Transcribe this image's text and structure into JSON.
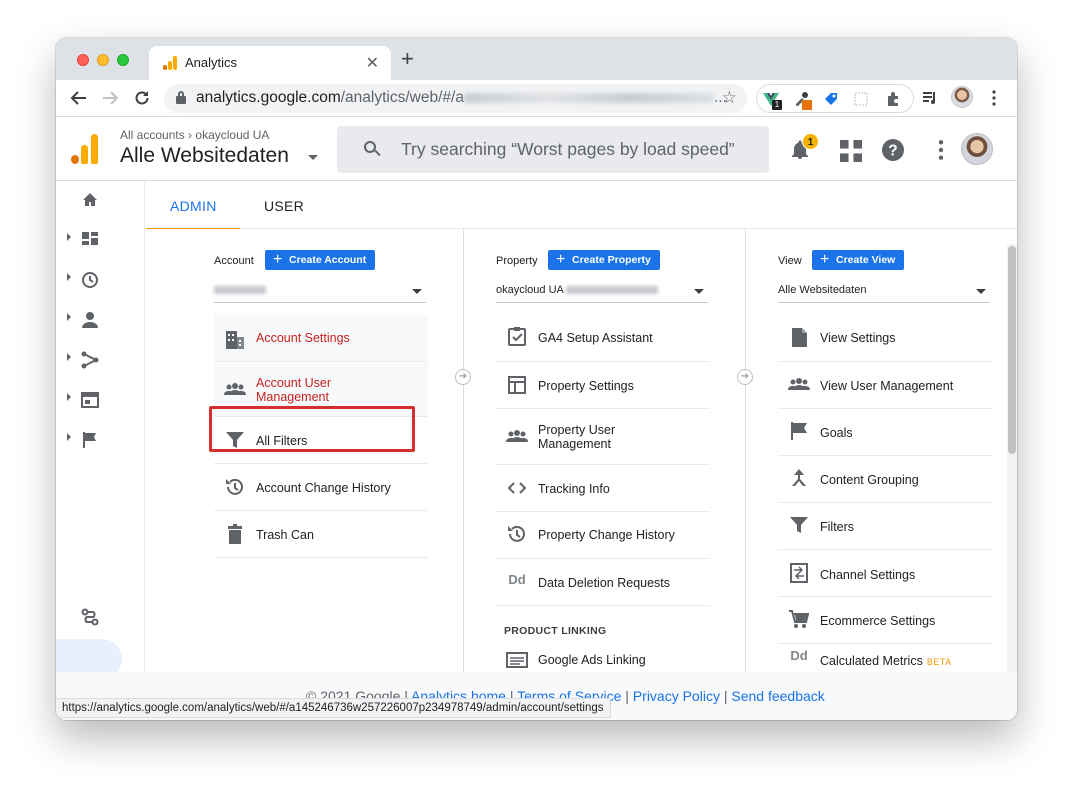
{
  "browser": {
    "tab_title": "Analytics",
    "tab_close": "✕",
    "new_tab": "+",
    "url_host": "analytics.google.com",
    "url_path": "/analytics/web/#/",
    "url_prefix_char": "a",
    "url_ellipsis": "...",
    "status_url": "https://analytics.google.com/analytics/web/#/a145246736w257226007p234978749/admin/account/settings",
    "ext_badge_1": "1"
  },
  "header": {
    "breadcrumb_root": "All accounts",
    "breadcrumb_sep": "›",
    "breadcrumb_account": "okaycloud UA",
    "view_title": "Alle Websitedaten",
    "search_placeholder": "Try searching “Worst pages by load speed”",
    "notification_count": "1"
  },
  "tabs": {
    "admin": "ADMIN",
    "user": "USER"
  },
  "account": {
    "label": "Account",
    "create": "Create Account",
    "items": [
      {
        "label": "Account Settings",
        "icon": "building-icon"
      },
      {
        "label": "Account User Management",
        "icon": "people-icon"
      },
      {
        "label": "All Filters",
        "icon": "filter-icon"
      },
      {
        "label": "Account Change History",
        "icon": "history-icon"
      },
      {
        "label": "Trash Can",
        "icon": "trash-icon"
      }
    ]
  },
  "property": {
    "label": "Property",
    "create": "Create Property",
    "selected": "okaycloud UA",
    "items": [
      {
        "label": "GA4 Setup Assistant",
        "icon": "checkbox-icon"
      },
      {
        "label": "Property Settings",
        "icon": "layout-icon"
      },
      {
        "label": "Property User Management",
        "icon": "people-icon"
      },
      {
        "label": "Tracking Info",
        "icon": "code-icon"
      },
      {
        "label": "Property Change History",
        "icon": "history-icon"
      },
      {
        "label": "Data Deletion Requests",
        "icon": "dd-icon",
        "glyph": "Dd"
      }
    ],
    "section_product_linking": "PRODUCT LINKING",
    "linking_items": [
      {
        "label": "Google Ads Linking",
        "icon": "ads-icon"
      }
    ]
  },
  "view": {
    "label": "View",
    "create": "Create View",
    "selected": "Alle Websitedaten",
    "items": [
      {
        "label": "View Settings",
        "icon": "document-icon"
      },
      {
        "label": "View User Management",
        "icon": "people-icon"
      },
      {
        "label": "Goals",
        "icon": "flag-icon"
      },
      {
        "label": "Content Grouping",
        "icon": "grouping-icon"
      },
      {
        "label": "Filters",
        "icon": "filter-icon"
      },
      {
        "label": "Channel Settings",
        "icon": "channel-icon"
      },
      {
        "label": "Ecommerce Settings",
        "icon": "cart-icon"
      },
      {
        "label": "Calculated Metrics",
        "icon": "dd-icon",
        "glyph": "Dd",
        "badge": "BETA"
      }
    ]
  },
  "footer": {
    "copyright": "© 2021 Google | ",
    "links": [
      "Analytics home",
      "Terms of Service",
      "Privacy Policy",
      "Send feedback"
    ],
    "sep": " | "
  },
  "colors": {
    "accent": "#1a73e8",
    "selected_text": "#c5221f",
    "highlight": "#d32f2f",
    "tab_indicator": "#f29900",
    "ga_orange": "#f9ab00",
    "ga_dark_orange": "#e37400"
  }
}
